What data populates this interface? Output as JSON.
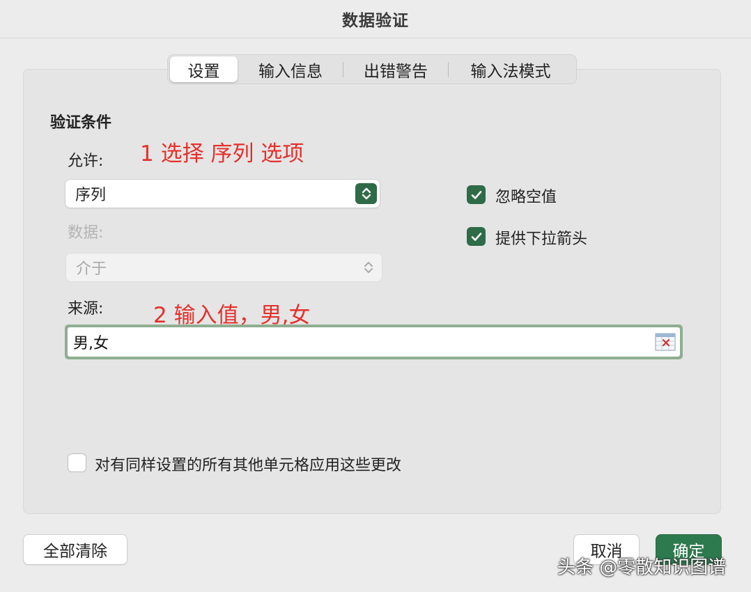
{
  "window": {
    "title": "数据验证"
  },
  "tabs": [
    {
      "label": "设置",
      "active": true
    },
    {
      "label": "输入信息",
      "active": false
    },
    {
      "label": "出错警告",
      "active": false
    },
    {
      "label": "输入法模式",
      "active": false
    }
  ],
  "settings": {
    "section_title": "验证条件",
    "allow_label": "允许:",
    "allow_value": "序列",
    "data_label": "数据:",
    "data_value": "介于",
    "source_label": "来源:",
    "source_value": "男,女",
    "ignore_blank": {
      "label": "忽略空值",
      "checked": true
    },
    "dropdown_arrow": {
      "label": "提供下拉箭头",
      "checked": true
    },
    "apply_all": {
      "label": "对有同样设置的所有其他单元格应用这些更改",
      "checked": false
    }
  },
  "annotations": {
    "step1": "1 选择 序列 选项",
    "step2": "2 输入值，男,女"
  },
  "buttons": {
    "clear_all": "全部清除",
    "cancel": "取消",
    "ok": "确定"
  },
  "watermark": "头条 @零散知识图谱",
  "colors": {
    "accent_green": "#2e6b47",
    "annotation_red": "#e5302b",
    "ok_button": "#2e7a4f"
  },
  "icons": {
    "allow_stepper": "chevron-up-down-icon",
    "data_stepper": "chevron-up-down-icon",
    "source_picker": "range-picker-icon",
    "checkbox": "checkmark-icon"
  }
}
